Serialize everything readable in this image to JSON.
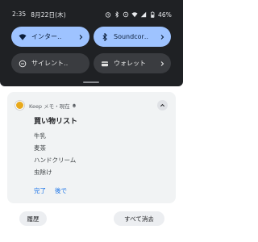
{
  "status_bar": {
    "time": "2:35",
    "date": "8月22日(木)",
    "battery": "46%"
  },
  "quick_settings": {
    "tiles": [
      {
        "label": "インター‥",
        "state": "on",
        "icon": "wifi-icon"
      },
      {
        "label": "Soundcor‥",
        "state": "on",
        "icon": "bluetooth-icon"
      },
      {
        "label": "サイレント‥",
        "state": "off",
        "icon": "do-not-disturb-icon"
      },
      {
        "label": "ウォレット",
        "state": "off",
        "icon": "wallet-icon"
      }
    ]
  },
  "notification": {
    "app": "Keep メモ・",
    "time": "現在",
    "title": "買い物リスト",
    "items": [
      "牛乳",
      "麦茶",
      "ハンドクリーム",
      "虫除け"
    ],
    "actions": [
      "完了",
      "後で"
    ]
  },
  "footer": {
    "history_label": "履歴",
    "clear_all_label": "すべて消去"
  }
}
